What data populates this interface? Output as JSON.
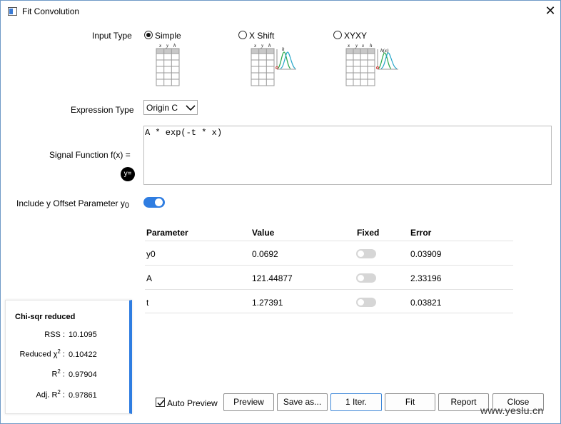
{
  "window": {
    "title": "Fit Convolution",
    "close_glyph": "✕"
  },
  "input_type": {
    "label": "Input Type",
    "options": [
      {
        "label": "Simple",
        "selected": true,
        "cols": [
          "x",
          "y",
          "h"
        ]
      },
      {
        "label": "X Shift",
        "selected": false,
        "cols": [
          "x",
          "y",
          "h"
        ]
      },
      {
        "label": "XYXY",
        "selected": false,
        "cols": [
          "x",
          "y",
          "x",
          "h"
        ],
        "curve_label": "h(x)"
      }
    ]
  },
  "expression_type": {
    "label": "Expression Type",
    "value": "Origin C"
  },
  "signal_function": {
    "label": "Signal Function f(x) =",
    "value": "A * exp(-t * x)",
    "y_button": "y="
  },
  "offset": {
    "label": "Include y Offset Parameter y",
    "sub": "0",
    "on": true
  },
  "params_table": {
    "headers": [
      "Parameter",
      "Value",
      "Fixed",
      "Error"
    ],
    "rows": [
      {
        "param": "y0",
        "value": "0.0692",
        "fixed": false,
        "error": "0.03909"
      },
      {
        "param": "A",
        "value": "121.44877",
        "fixed": false,
        "error": "2.33196"
      },
      {
        "param": "t",
        "value": "1.27391",
        "fixed": false,
        "error": "0.03821"
      }
    ]
  },
  "stats": {
    "title": "Chi-sqr reduced",
    "rss_label": "RSS :",
    "rss": "10.1095",
    "chi_label": "Reduced χ",
    "chi_sup": "2",
    "chi_colon": " :",
    "chi": "0.10422",
    "r2_label": "R",
    "r2_sup": "2",
    "r2_colon": " :",
    "r2": "0.97904",
    "adjr2_label": "Adj. R",
    "adjr2_sup": "2",
    "adjr2_colon": " :",
    "adjr2": "0.97861"
  },
  "footer": {
    "auto_preview": {
      "label": "Auto Preview",
      "checked": true
    },
    "buttons": [
      "Preview",
      "Save as...",
      "1 Iter.",
      "Fit",
      "Report",
      "Close"
    ]
  },
  "watermark": "www.yeslu.cn",
  "colors": {
    "accent": "#2f7de1",
    "curve_green": "#2aa84a",
    "curve_teal": "#25a6c9",
    "curve_red": "#e0302b"
  }
}
